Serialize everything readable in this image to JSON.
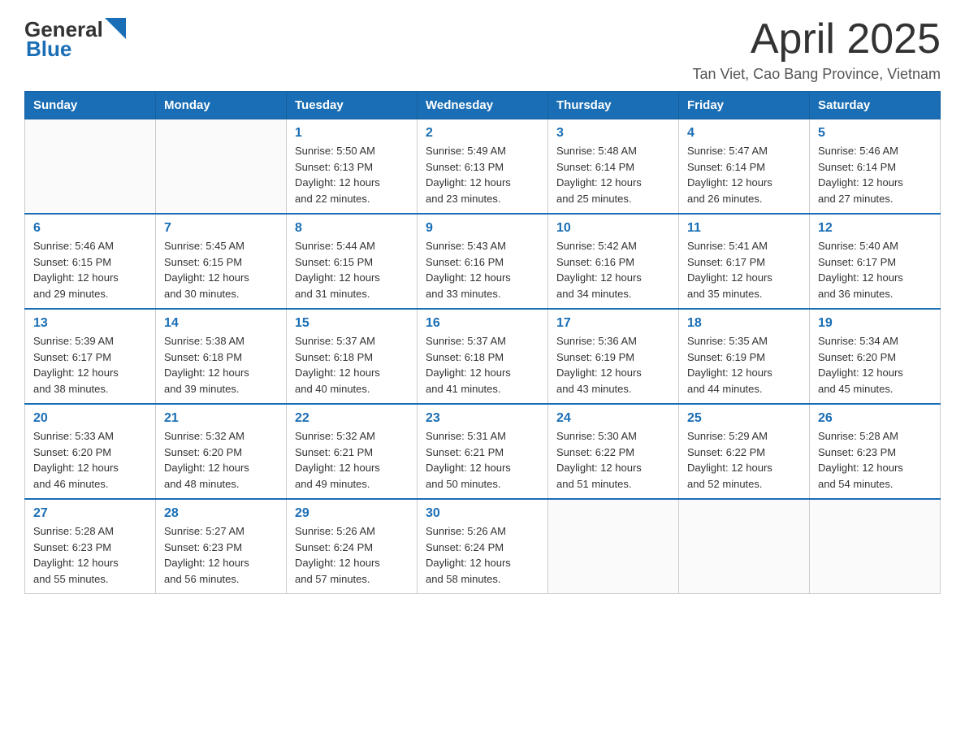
{
  "header": {
    "logo_general": "General",
    "logo_blue": "Blue",
    "title": "April 2025",
    "location": "Tan Viet, Cao Bang Province, Vietnam"
  },
  "days_of_week": [
    "Sunday",
    "Monday",
    "Tuesday",
    "Wednesday",
    "Thursday",
    "Friday",
    "Saturday"
  ],
  "weeks": [
    [
      {
        "day": "",
        "info": ""
      },
      {
        "day": "",
        "info": ""
      },
      {
        "day": "1",
        "info": "Sunrise: 5:50 AM\nSunset: 6:13 PM\nDaylight: 12 hours\nand 22 minutes."
      },
      {
        "day": "2",
        "info": "Sunrise: 5:49 AM\nSunset: 6:13 PM\nDaylight: 12 hours\nand 23 minutes."
      },
      {
        "day": "3",
        "info": "Sunrise: 5:48 AM\nSunset: 6:14 PM\nDaylight: 12 hours\nand 25 minutes."
      },
      {
        "day": "4",
        "info": "Sunrise: 5:47 AM\nSunset: 6:14 PM\nDaylight: 12 hours\nand 26 minutes."
      },
      {
        "day": "5",
        "info": "Sunrise: 5:46 AM\nSunset: 6:14 PM\nDaylight: 12 hours\nand 27 minutes."
      }
    ],
    [
      {
        "day": "6",
        "info": "Sunrise: 5:46 AM\nSunset: 6:15 PM\nDaylight: 12 hours\nand 29 minutes."
      },
      {
        "day": "7",
        "info": "Sunrise: 5:45 AM\nSunset: 6:15 PM\nDaylight: 12 hours\nand 30 minutes."
      },
      {
        "day": "8",
        "info": "Sunrise: 5:44 AM\nSunset: 6:15 PM\nDaylight: 12 hours\nand 31 minutes."
      },
      {
        "day": "9",
        "info": "Sunrise: 5:43 AM\nSunset: 6:16 PM\nDaylight: 12 hours\nand 33 minutes."
      },
      {
        "day": "10",
        "info": "Sunrise: 5:42 AM\nSunset: 6:16 PM\nDaylight: 12 hours\nand 34 minutes."
      },
      {
        "day": "11",
        "info": "Sunrise: 5:41 AM\nSunset: 6:17 PM\nDaylight: 12 hours\nand 35 minutes."
      },
      {
        "day": "12",
        "info": "Sunrise: 5:40 AM\nSunset: 6:17 PM\nDaylight: 12 hours\nand 36 minutes."
      }
    ],
    [
      {
        "day": "13",
        "info": "Sunrise: 5:39 AM\nSunset: 6:17 PM\nDaylight: 12 hours\nand 38 minutes."
      },
      {
        "day": "14",
        "info": "Sunrise: 5:38 AM\nSunset: 6:18 PM\nDaylight: 12 hours\nand 39 minutes."
      },
      {
        "day": "15",
        "info": "Sunrise: 5:37 AM\nSunset: 6:18 PM\nDaylight: 12 hours\nand 40 minutes."
      },
      {
        "day": "16",
        "info": "Sunrise: 5:37 AM\nSunset: 6:18 PM\nDaylight: 12 hours\nand 41 minutes."
      },
      {
        "day": "17",
        "info": "Sunrise: 5:36 AM\nSunset: 6:19 PM\nDaylight: 12 hours\nand 43 minutes."
      },
      {
        "day": "18",
        "info": "Sunrise: 5:35 AM\nSunset: 6:19 PM\nDaylight: 12 hours\nand 44 minutes."
      },
      {
        "day": "19",
        "info": "Sunrise: 5:34 AM\nSunset: 6:20 PM\nDaylight: 12 hours\nand 45 minutes."
      }
    ],
    [
      {
        "day": "20",
        "info": "Sunrise: 5:33 AM\nSunset: 6:20 PM\nDaylight: 12 hours\nand 46 minutes."
      },
      {
        "day": "21",
        "info": "Sunrise: 5:32 AM\nSunset: 6:20 PM\nDaylight: 12 hours\nand 48 minutes."
      },
      {
        "day": "22",
        "info": "Sunrise: 5:32 AM\nSunset: 6:21 PM\nDaylight: 12 hours\nand 49 minutes."
      },
      {
        "day": "23",
        "info": "Sunrise: 5:31 AM\nSunset: 6:21 PM\nDaylight: 12 hours\nand 50 minutes."
      },
      {
        "day": "24",
        "info": "Sunrise: 5:30 AM\nSunset: 6:22 PM\nDaylight: 12 hours\nand 51 minutes."
      },
      {
        "day": "25",
        "info": "Sunrise: 5:29 AM\nSunset: 6:22 PM\nDaylight: 12 hours\nand 52 minutes."
      },
      {
        "day": "26",
        "info": "Sunrise: 5:28 AM\nSunset: 6:23 PM\nDaylight: 12 hours\nand 54 minutes."
      }
    ],
    [
      {
        "day": "27",
        "info": "Sunrise: 5:28 AM\nSunset: 6:23 PM\nDaylight: 12 hours\nand 55 minutes."
      },
      {
        "day": "28",
        "info": "Sunrise: 5:27 AM\nSunset: 6:23 PM\nDaylight: 12 hours\nand 56 minutes."
      },
      {
        "day": "29",
        "info": "Sunrise: 5:26 AM\nSunset: 6:24 PM\nDaylight: 12 hours\nand 57 minutes."
      },
      {
        "day": "30",
        "info": "Sunrise: 5:26 AM\nSunset: 6:24 PM\nDaylight: 12 hours\nand 58 minutes."
      },
      {
        "day": "",
        "info": ""
      },
      {
        "day": "",
        "info": ""
      },
      {
        "day": "",
        "info": ""
      }
    ]
  ]
}
